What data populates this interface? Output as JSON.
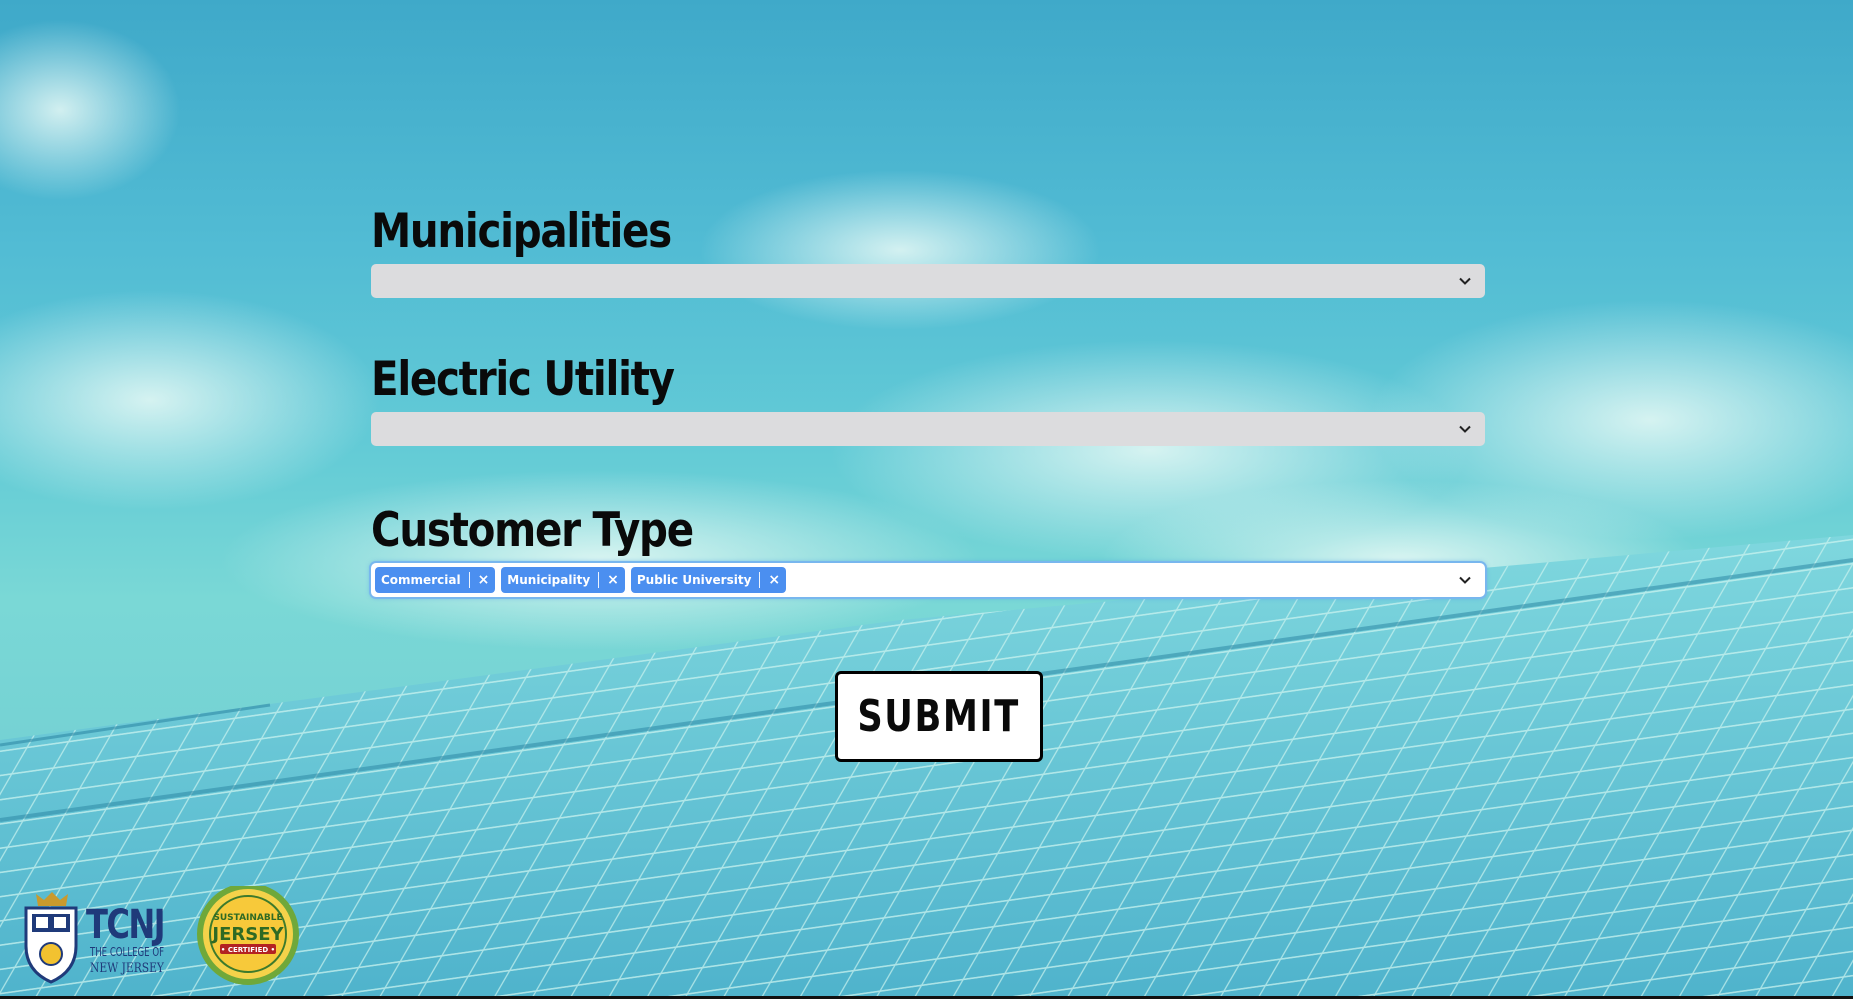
{
  "form": {
    "municipalities": {
      "label": "Municipalities",
      "value": ""
    },
    "electric_utility": {
      "label": "Electric Utility",
      "value": ""
    },
    "customer_type": {
      "label": "Customer Type",
      "selected": [
        "Commercial",
        "Municipality",
        "Public University"
      ]
    }
  },
  "actions": {
    "submit_label": "SUBMIT"
  },
  "logos": {
    "tcnj_lettering": "TCNJ THE COLLEGE OF NEW JERSEY",
    "sustainable_jersey_lettering": "SUSTAINABLE JERSEY CERTIFIED"
  },
  "icons": {
    "dropdown": "chevron-down-icon",
    "remove_tag": "close-icon"
  },
  "colors": {
    "tag_bg": "#4b8ff0",
    "select_bg": "#dcdcde",
    "focus_ring": "#78b7ee"
  }
}
